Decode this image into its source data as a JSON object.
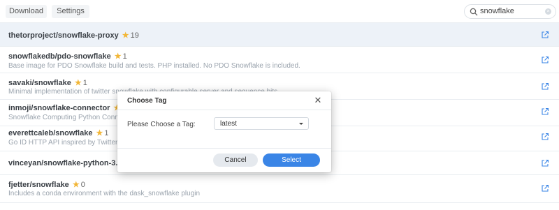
{
  "toolbar": {
    "download_label": "Download",
    "settings_label": "Settings",
    "search_value": "snowflake"
  },
  "results": [
    {
      "name": "thetorproject/snowflake-proxy",
      "stars": "19",
      "description": ""
    },
    {
      "name": "snowflakedb/pdo-snowflake",
      "stars": "1",
      "description": "Base image for PDO Snowflake build and tests. PHP installed. No PDO Snowflake is included."
    },
    {
      "name": "savaki/snowflake",
      "stars": "1",
      "description": "Minimal implementation of twitter snowflake with configurable server and sequence bits"
    },
    {
      "name": "inmoji/snowflake-connector",
      "stars": "",
      "description": "Snowflake Computing Python Connector"
    },
    {
      "name": "everettcaleb/snowflake",
      "stars": "1",
      "description": "Go ID HTTP API inspired by Twitter"
    },
    {
      "name": "vinceyan/snowflake-python-3.1",
      "stars": "",
      "description": ""
    },
    {
      "name": "fjetter/snowflake",
      "stars": "0",
      "description": "Includes a conda environment with the dask_snowflake plugin"
    }
  ],
  "dialog": {
    "title": "Choose Tag",
    "label": "Please Choose a Tag:",
    "selected_tag": "latest",
    "cancel_label": "Cancel",
    "select_label": "Select"
  },
  "colors": {
    "primary_button": "#3a85e6",
    "star": "#f2b636",
    "selected_row": "#edf2f8"
  }
}
